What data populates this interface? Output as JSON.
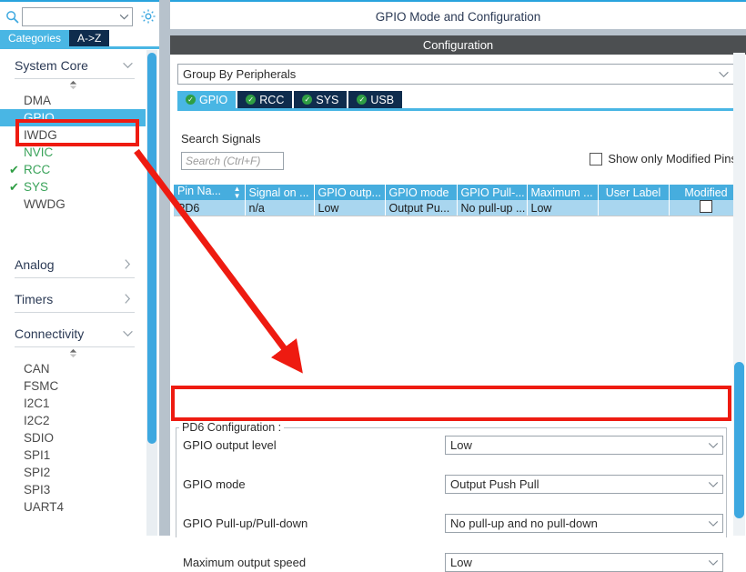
{
  "left_panel": {
    "search": {
      "value": "",
      "icon": "search-icon"
    },
    "gear_icon": "gear-icon",
    "tabs": [
      {
        "label": "Categories",
        "active": true
      },
      {
        "label": "A->Z",
        "active": false
      }
    ],
    "groups": [
      {
        "name": "System Core",
        "expanded": true,
        "chevron": "chevron-down-icon",
        "items": [
          {
            "label": "DMA",
            "checked": false,
            "selected": false,
            "green": false
          },
          {
            "label": "GPIO",
            "checked": false,
            "selected": true,
            "green": false
          },
          {
            "label": "IWDG",
            "checked": false,
            "selected": false,
            "green": false
          },
          {
            "label": "NVIC",
            "checked": false,
            "selected": false,
            "green": true
          },
          {
            "label": "RCC",
            "checked": true,
            "selected": false,
            "green": true
          },
          {
            "label": "SYS",
            "checked": true,
            "selected": false,
            "green": true
          },
          {
            "label": "WWDG",
            "checked": false,
            "selected": false,
            "green": false
          }
        ]
      },
      {
        "name": "Analog",
        "expanded": false,
        "chevron": "chevron-right-icon",
        "items": []
      },
      {
        "name": "Timers",
        "expanded": false,
        "chevron": "chevron-right-icon",
        "items": []
      },
      {
        "name": "Connectivity",
        "expanded": true,
        "chevron": "chevron-down-icon",
        "items": [
          {
            "label": "CAN",
            "checked": false,
            "selected": false,
            "green": false
          },
          {
            "label": "FSMC",
            "checked": false,
            "selected": false,
            "green": false
          },
          {
            "label": "I2C1",
            "checked": false,
            "selected": false,
            "green": false
          },
          {
            "label": "I2C2",
            "checked": false,
            "selected": false,
            "green": false
          },
          {
            "label": "SDIO",
            "checked": false,
            "selected": false,
            "green": false
          },
          {
            "label": "SPI1",
            "checked": false,
            "selected": false,
            "green": false
          },
          {
            "label": "SPI2",
            "checked": false,
            "selected": false,
            "green": false
          },
          {
            "label": "SPI3",
            "checked": false,
            "selected": false,
            "green": false
          },
          {
            "label": "UART4",
            "checked": false,
            "selected": false,
            "green": false
          }
        ]
      }
    ]
  },
  "right_panel": {
    "mode_title": "GPIO Mode and Configuration",
    "configuration_bar": "Configuration",
    "group_by": {
      "value": "Group By Peripherals",
      "chevron": "chevron-down-icon"
    },
    "peripheral_tabs": [
      {
        "label": "GPIO",
        "active": true,
        "status": "ok"
      },
      {
        "label": "RCC",
        "active": false,
        "status": "ok"
      },
      {
        "label": "SYS",
        "active": false,
        "status": "ok"
      },
      {
        "label": "USB",
        "active": false,
        "status": "ok"
      }
    ],
    "search_signals_label": "Search Signals",
    "search_signals": {
      "value": "",
      "placeholder": "Search (Ctrl+F)"
    },
    "show_only_modified": {
      "label": "Show only Modified Pins",
      "checked": false
    },
    "pins_table": {
      "columns": [
        "Pin Na...",
        "Signal on ...",
        "GPIO outp...",
        "GPIO mode",
        "GPIO Pull-...",
        "Maximum ...",
        "User Label",
        "Modified"
      ],
      "rows": [
        {
          "pin_name": "PD6",
          "signal_on": "n/a",
          "gpio_output": "Low",
          "gpio_mode": "Output Pu...",
          "gpio_pull": "No pull-up ...",
          "maximum": "Low",
          "user_label": "",
          "modified": false
        }
      ]
    },
    "pd6_config": {
      "legend": "PD6 Configuration :",
      "rows": [
        {
          "label": "GPIO output level",
          "value": "Low",
          "highlighted": true
        },
        {
          "label": "GPIO mode",
          "value": "Output Push Pull",
          "highlighted": false
        },
        {
          "label": "GPIO Pull-up/Pull-down",
          "value": "No pull-up and no pull-down",
          "highlighted": false
        },
        {
          "label": "Maximum output speed",
          "value": "Low",
          "highlighted": false
        }
      ]
    }
  },
  "annotations": {
    "color": "#ee1b11",
    "boxes": [
      "gpio-sidebar-node",
      "gpio-output-level-row"
    ],
    "arrow": "points from GPIO sidebar node to PD6 Configuration section"
  }
}
